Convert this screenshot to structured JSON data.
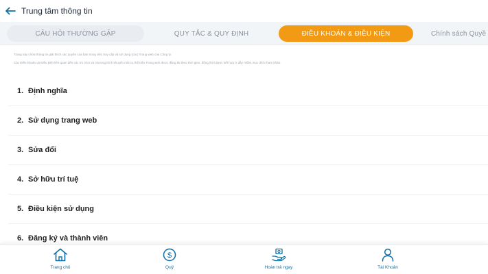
{
  "header": {
    "title": "Trung tâm thông tin"
  },
  "tabs": [
    {
      "label": "CÂU HỎI THƯỜNG GẶP"
    },
    {
      "label": "QUY TẮC & QUY ĐỊNH"
    },
    {
      "label": "ĐIỀU KHOẢN & ĐIỀU KIỆN"
    },
    {
      "label": "Chính sách Quyề"
    }
  ],
  "active_tab_index": 2,
  "intro": {
    "line1": "Trang này chứa thông tin giải thích các quyền của bạn trong việc truy cập và sử dụng (các) Trang web của Công ty.",
    "line2": "Các Điều khoản và Điều kiện liên quan đến các trò chơi và chương trình khuyến mãi cụ thể trên Trang web được đăng tải theo thời gian, đồng thời được kết hợp ở đây nhằm mục đích tham khảo."
  },
  "terms": [
    {
      "num": "1.",
      "label": "Định nghĩa"
    },
    {
      "num": "2.",
      "label": "Sử dụng trang web"
    },
    {
      "num": "3.",
      "label": "Sửa đổi"
    },
    {
      "num": "4.",
      "label": "Sở hữu trí tuệ"
    },
    {
      "num": "5.",
      "label": "Điều kiện sử dụng"
    },
    {
      "num": "6.",
      "label": "Đăng ký và thành viên"
    }
  ],
  "bottom_nav": [
    {
      "label": "Trang chủ",
      "icon": "home-icon"
    },
    {
      "label": "Quỹ",
      "icon": "dollar-coin-icon"
    },
    {
      "label": "Hoàn trả ngay",
      "icon": "money-hand-icon"
    },
    {
      "label": "Tài Khoản",
      "icon": "user-icon"
    }
  ],
  "colors": {
    "accent": "#f39a14",
    "primary": "#0d6ea8",
    "tab_bar_bg": "#f2f5f8"
  }
}
